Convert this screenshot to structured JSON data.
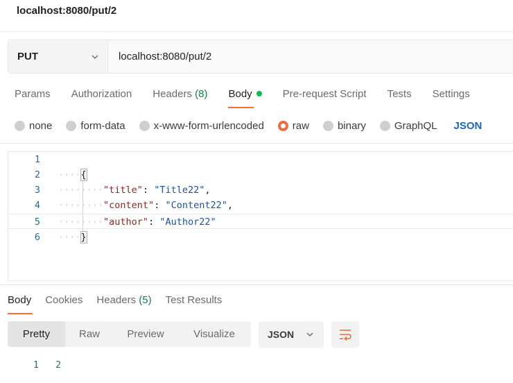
{
  "window": {
    "title": "localhost:8080/put/2"
  },
  "request": {
    "method": "PUT",
    "url": "localhost:8080/put/2"
  },
  "request_tabs": {
    "params": "Params",
    "authorization": "Authorization",
    "headers": "Headers",
    "headers_count": "(8)",
    "body": "Body",
    "prerequest": "Pre-request Script",
    "tests": "Tests",
    "settings": "Settings"
  },
  "body_types": {
    "none": "none",
    "form_data": "form-data",
    "urlencoded": "x-www-form-urlencoded",
    "raw": "raw",
    "binary": "binary",
    "graphql": "GraphQL",
    "format": "JSON",
    "selected": "raw"
  },
  "editor": {
    "lines": [
      {
        "n": "1",
        "ws": "",
        "open": "",
        "key": "",
        "sep": "",
        "val": "",
        "tail": ""
      },
      {
        "n": "2",
        "ws": "····",
        "open": "{",
        "key": "",
        "sep": "",
        "val": "",
        "tail": ""
      },
      {
        "n": "3",
        "ws": "········",
        "open": "",
        "key": "\"title\"",
        "sep": ": ",
        "val": "\"Title22\"",
        "tail": ","
      },
      {
        "n": "4",
        "ws": "········",
        "open": "",
        "key": "\"content\"",
        "sep": ": ",
        "val": "\"Content22\"",
        "tail": ","
      },
      {
        "n": "5",
        "ws": "········",
        "open": "",
        "key": "\"author\"",
        "sep": ": ",
        "val": "\"Author22\"",
        "tail": ""
      },
      {
        "n": "6",
        "ws": "····",
        "open": "}",
        "key": "",
        "sep": "",
        "val": "",
        "tail": ""
      }
    ]
  },
  "response_tabs": {
    "body": "Body",
    "cookies": "Cookies",
    "headers": "Headers",
    "headers_count": "(5)",
    "test_results": "Test Results"
  },
  "response_view": {
    "pretty": "Pretty",
    "raw": "Raw",
    "preview": "Preview",
    "visualize": "Visualize",
    "format": "JSON",
    "wrap_icon": "wrap-lines-icon"
  },
  "response_body": {
    "line_number": "1",
    "content": "2"
  },
  "colors": {
    "accent": "#ff6c37",
    "active_dot": "#0cbb52",
    "link": "#1a67c2"
  }
}
